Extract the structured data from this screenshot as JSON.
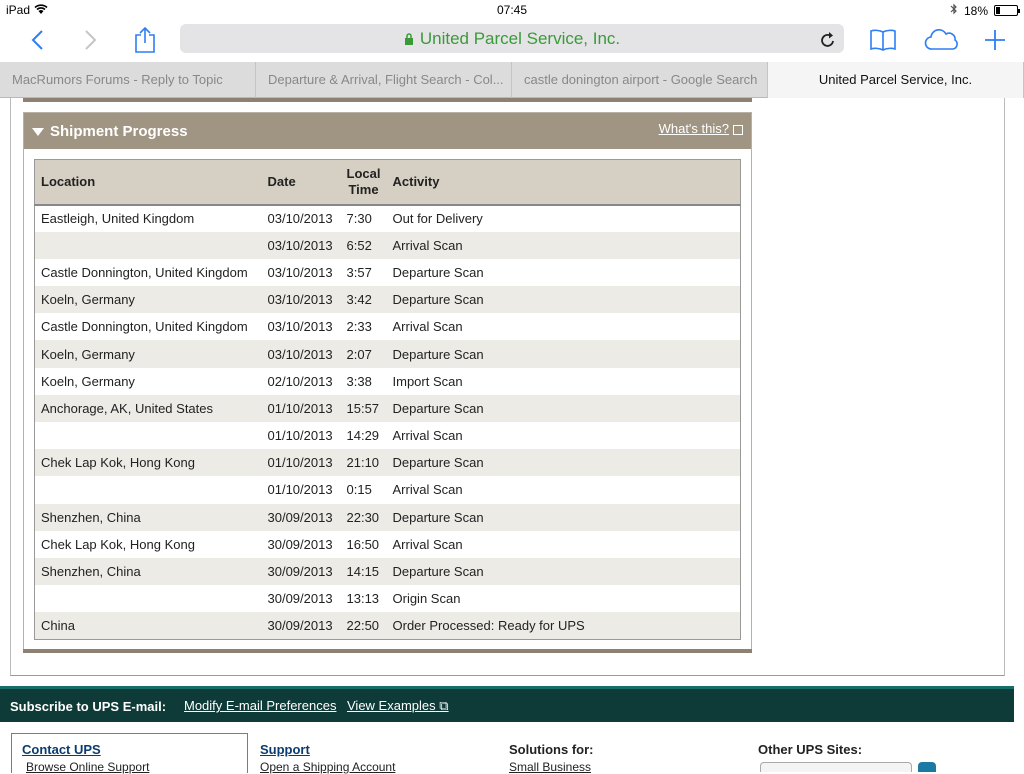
{
  "status_bar": {
    "device": "iPad",
    "time": "07:45",
    "battery": "18%"
  },
  "browser": {
    "url_title": "United Parcel Service, Inc.",
    "tabs": [
      {
        "label": "MacRumors Forums - Reply to Topic"
      },
      {
        "label": "Departure & Arrival, Flight Search - Col..."
      },
      {
        "label": "castle donington airport - Google Search"
      },
      {
        "label": "United Parcel Service, Inc."
      }
    ]
  },
  "panel": {
    "title": "Shipment Progress",
    "whats_this": "What's this?"
  },
  "table": {
    "headers": {
      "location": "Location",
      "date": "Date",
      "time_line1": "Local",
      "time_line2": "Time",
      "activity": "Activity"
    },
    "rows": [
      {
        "location": "Eastleigh, United Kingdom",
        "date": "03/10/2013",
        "time": "7:30",
        "activity": "Out for Delivery"
      },
      {
        "location": "",
        "date": "03/10/2013",
        "time": "6:52",
        "activity": "Arrival Scan"
      },
      {
        "location": "Castle Donnington, United Kingdom",
        "date": "03/10/2013",
        "time": "3:57",
        "activity": "Departure Scan"
      },
      {
        "location": "Koeln, Germany",
        "date": "03/10/2013",
        "time": "3:42",
        "activity": "Departure Scan"
      },
      {
        "location": "Castle Donnington, United Kingdom",
        "date": "03/10/2013",
        "time": "2:33",
        "activity": "Arrival Scan"
      },
      {
        "location": "Koeln, Germany",
        "date": "03/10/2013",
        "time": "2:07",
        "activity": "Departure Scan"
      },
      {
        "location": "Koeln, Germany",
        "date": "02/10/2013",
        "time": "3:38",
        "activity": "Import Scan"
      },
      {
        "location": "Anchorage, AK, United States",
        "date": "01/10/2013",
        "time": "15:57",
        "activity": "Departure Scan"
      },
      {
        "location": "",
        "date": "01/10/2013",
        "time": "14:29",
        "activity": "Arrival Scan"
      },
      {
        "location": "Chek Lap Kok, Hong Kong",
        "date": "01/10/2013",
        "time": "21:10",
        "activity": "Departure Scan"
      },
      {
        "location": "",
        "date": "01/10/2013",
        "time": "0:15",
        "activity": "Arrival Scan"
      },
      {
        "location": "Shenzhen, China",
        "date": "30/09/2013",
        "time": "22:30",
        "activity": "Departure Scan"
      },
      {
        "location": "Chek Lap Kok, Hong Kong",
        "date": "30/09/2013",
        "time": "16:50",
        "activity": "Arrival Scan"
      },
      {
        "location": "Shenzhen, China",
        "date": "30/09/2013",
        "time": "14:15",
        "activity": "Departure Scan"
      },
      {
        "location": "",
        "date": "30/09/2013",
        "time": "13:13",
        "activity": "Origin Scan"
      },
      {
        "location": "China",
        "date": "30/09/2013",
        "time": "22:50",
        "activity": "Order Processed: Ready for UPS"
      }
    ]
  },
  "subscribe": {
    "label": "Subscribe to UPS E-mail:",
    "modify": "Modify E-mail Preferences",
    "examples": "View Examples"
  },
  "footer": {
    "contact": "Contact UPS",
    "contact_sub": "Browse Online Support",
    "support": "Support",
    "support_sub": "Open a Shipping Account",
    "solutions": "Solutions for:",
    "solutions_sub": "Small Business",
    "other_sites": "Other UPS Sites:"
  },
  "colors": {
    "accent": "#2e7ef5",
    "panel_header": "#a09483",
    "footer_bar": "#0e3a37",
    "url_green": "#3a9a3a"
  }
}
